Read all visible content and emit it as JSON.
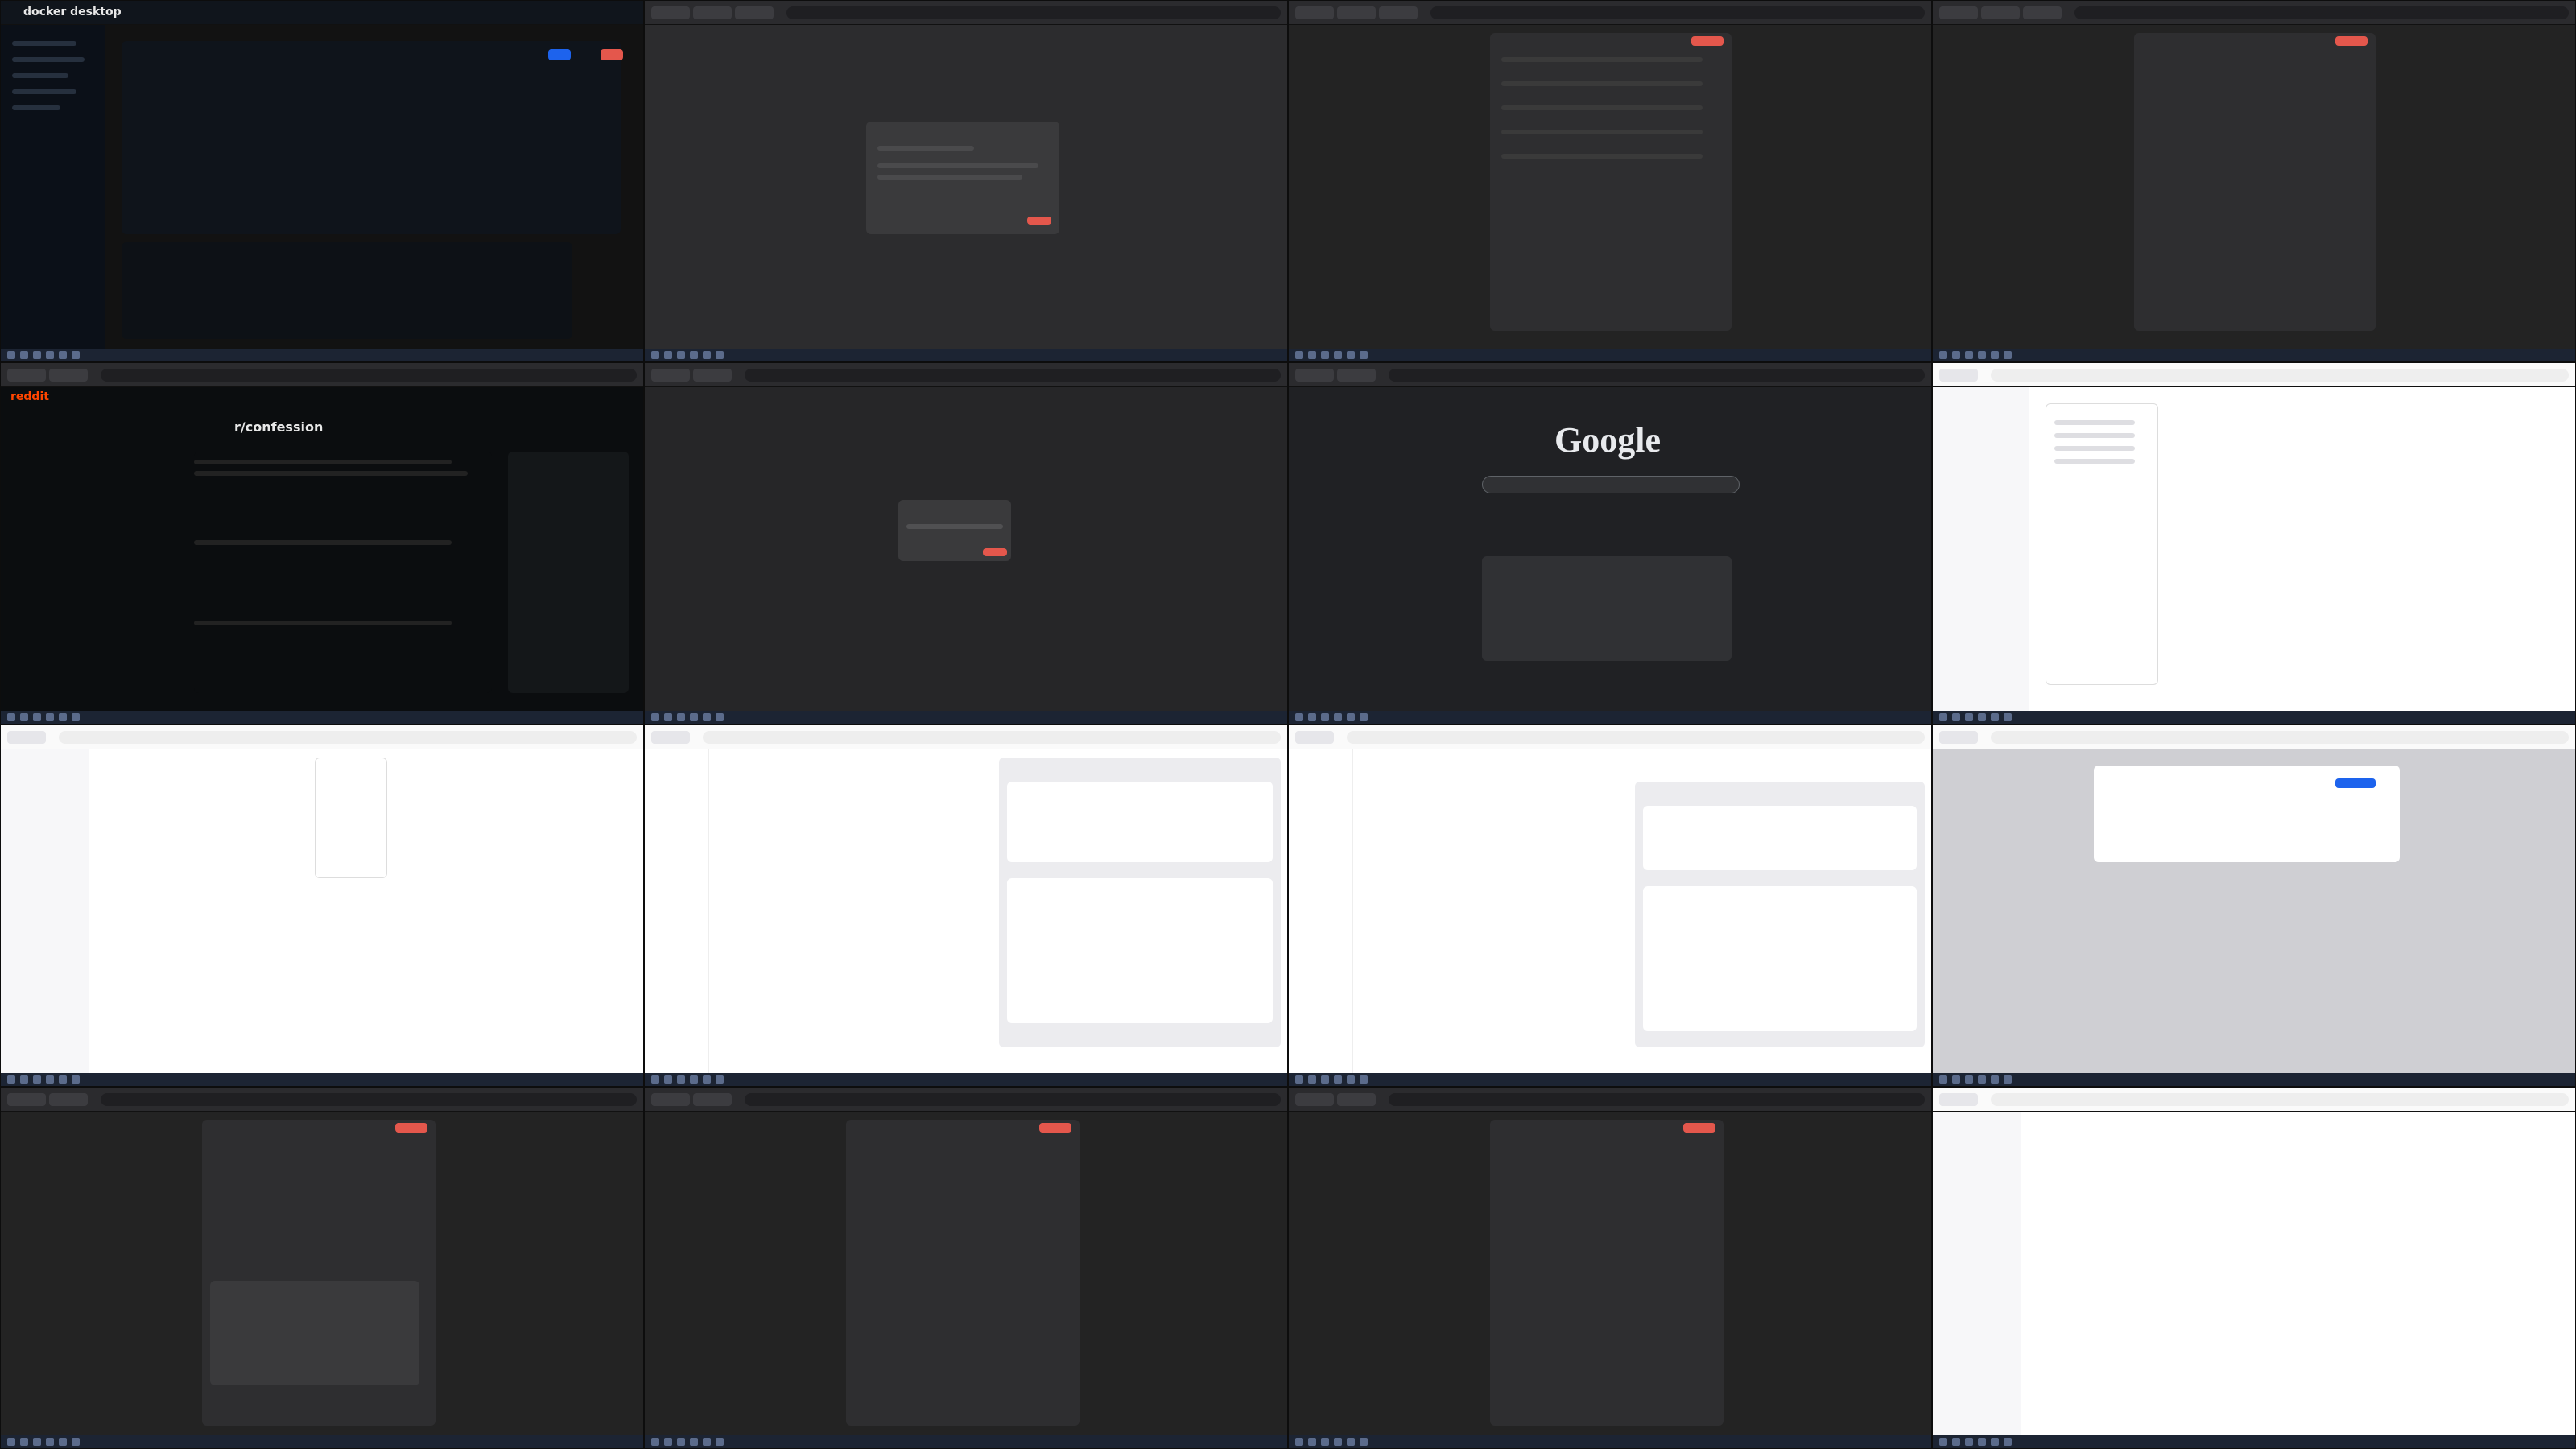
{
  "screens": {
    "docker": {
      "brand": "docker desktop"
    },
    "reddit": {
      "brand": "reddit",
      "community": "r/confession"
    },
    "google": {
      "logo": "Google"
    }
  },
  "colors": {
    "accent_red": "#e4574c",
    "docker_blue": "#1d63ed",
    "panel_dark": "#232323",
    "page_light": "#f4f4f6"
  }
}
